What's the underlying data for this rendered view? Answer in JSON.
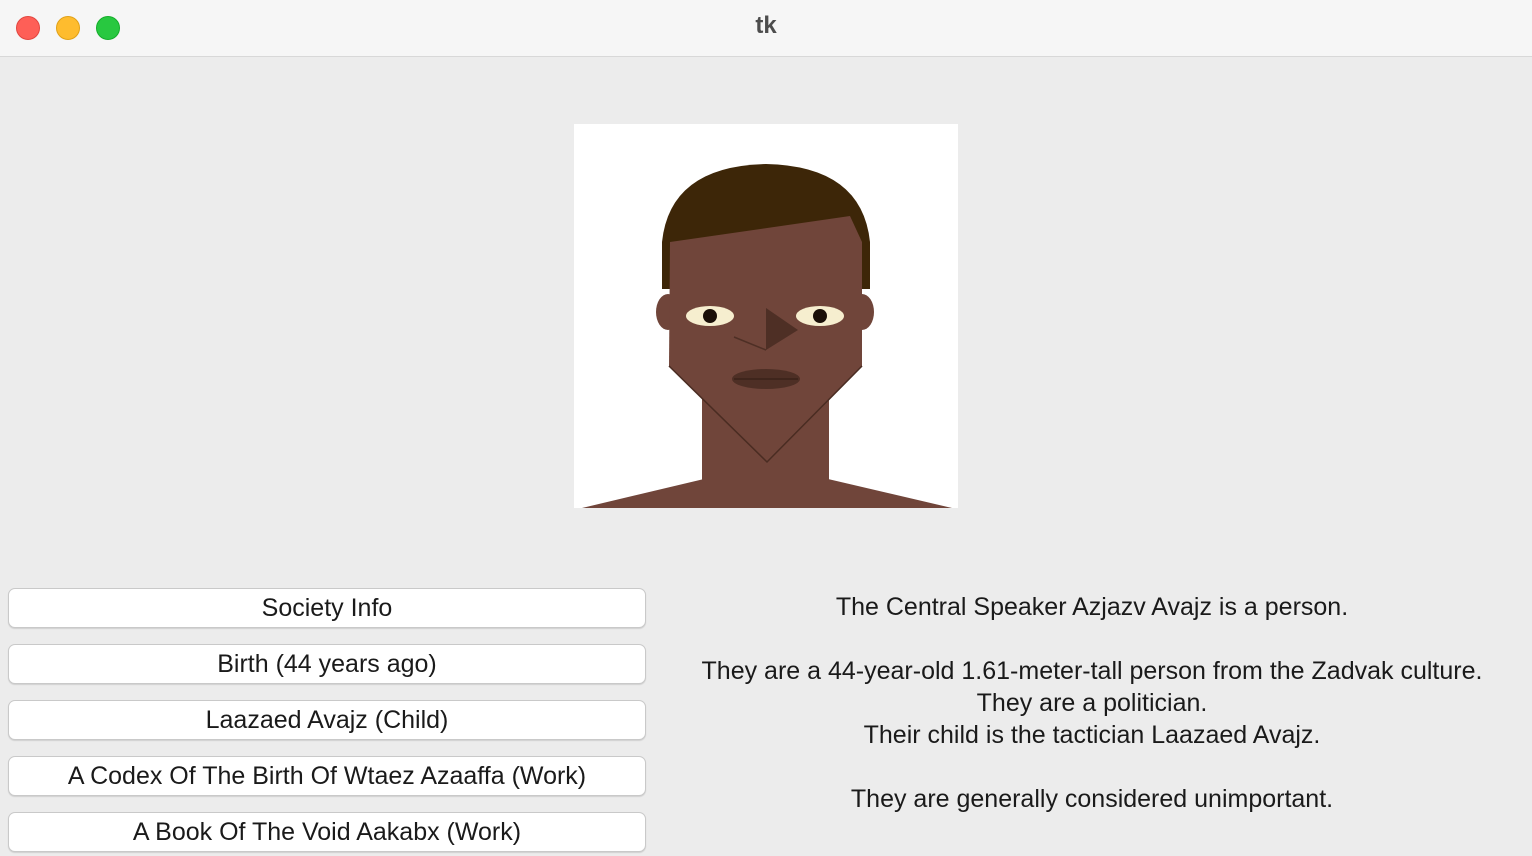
{
  "window": {
    "title": "tk"
  },
  "icons": {
    "close": "close-traffic-light",
    "minimize": "minimize-traffic-light",
    "maximize": "maximize-traffic-light",
    "portrait": "person-portrait-image"
  },
  "buttons": [
    {
      "label": "Society Info"
    },
    {
      "label": "Birth (44 years ago)"
    },
    {
      "label": "Laazaed Avajz (Child)"
    },
    {
      "label": "A Codex Of The Birth Of Wtaez Azaaffa (Work)"
    },
    {
      "label": "A Book Of The Void Aakabx (Work)"
    }
  ],
  "description": {
    "intro": "The Central Speaker Azjazv Avajz is a person.",
    "details": [
      "They are a 44-year-old 1.61-meter-tall person from the Zadvak culture.",
      "They are a politician.",
      "Their child is the tactician Laazaed Avajz."
    ],
    "importance": "They are generally considered unimportant."
  },
  "colors": {
    "background": "#ececec",
    "skin": "#70453a",
    "hair": "#3d2608",
    "eye_white": "#f6eecf"
  }
}
